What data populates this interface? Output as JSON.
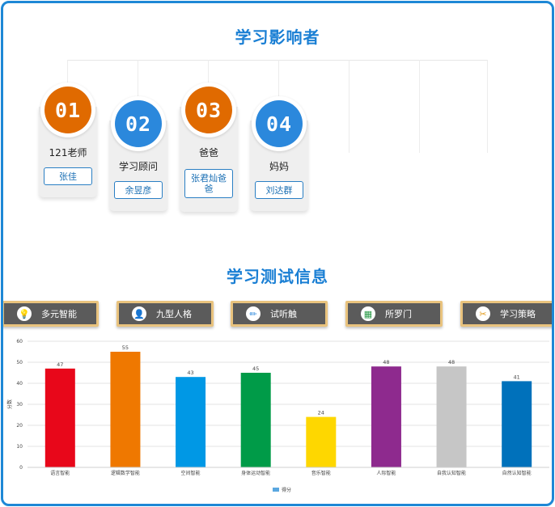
{
  "section1": {
    "title": "学习影响者"
  },
  "influencers": [
    {
      "num": "01",
      "role": "121老师",
      "name": "张佳",
      "color": "#e06a00"
    },
    {
      "num": "02",
      "role": "学习顾问",
      "name": "余昱彦",
      "color": "#2b88dc"
    },
    {
      "num": "03",
      "role": "爸爸",
      "name": "张君灿爸爸",
      "color": "#e06a00"
    },
    {
      "num": "04",
      "role": "妈妈",
      "name": "刘达群",
      "color": "#2b88dc"
    }
  ],
  "section2": {
    "title": "学习测试信息"
  },
  "tabs": [
    {
      "label": "多元智能",
      "icon": "bulb-icon",
      "glyph": "💡",
      "color": "#d8261c"
    },
    {
      "label": "九型人格",
      "icon": "person-icon",
      "glyph": "👤",
      "color": "#e29b1b"
    },
    {
      "label": "试听触",
      "icon": "pencil-icon",
      "glyph": "✏",
      "color": "#2b88dc"
    },
    {
      "label": "所罗门",
      "icon": "grid-icon",
      "glyph": "▦",
      "color": "#2a9a47"
    },
    {
      "label": "学习策略",
      "icon": "tools-icon",
      "glyph": "✂",
      "color": "#e29b1b"
    }
  ],
  "chart_data": {
    "type": "bar",
    "categories": [
      "语言智能",
      "逻辑数学智能",
      "空间智能",
      "身体运动智能",
      "音乐智能",
      "人际智能",
      "自我认知智能",
      "自然认知智能"
    ],
    "series": [
      {
        "name": "得分",
        "values": [
          47,
          55,
          43,
          45,
          24,
          48,
          48,
          41
        ]
      }
    ],
    "colors": [
      "#e8071a",
      "#ef7800",
      "#0098e5",
      "#009b48",
      "#fed700",
      "#8e2a8e",
      "#c6c6c6",
      "#0071bb"
    ],
    "ylabel": "分数",
    "ylim": [
      0,
      60
    ],
    "yticks": [
      0,
      10,
      20,
      30,
      40,
      50,
      60
    ],
    "grid": true,
    "legend": "bottom-center",
    "legend_color": "#5aa7e0"
  }
}
